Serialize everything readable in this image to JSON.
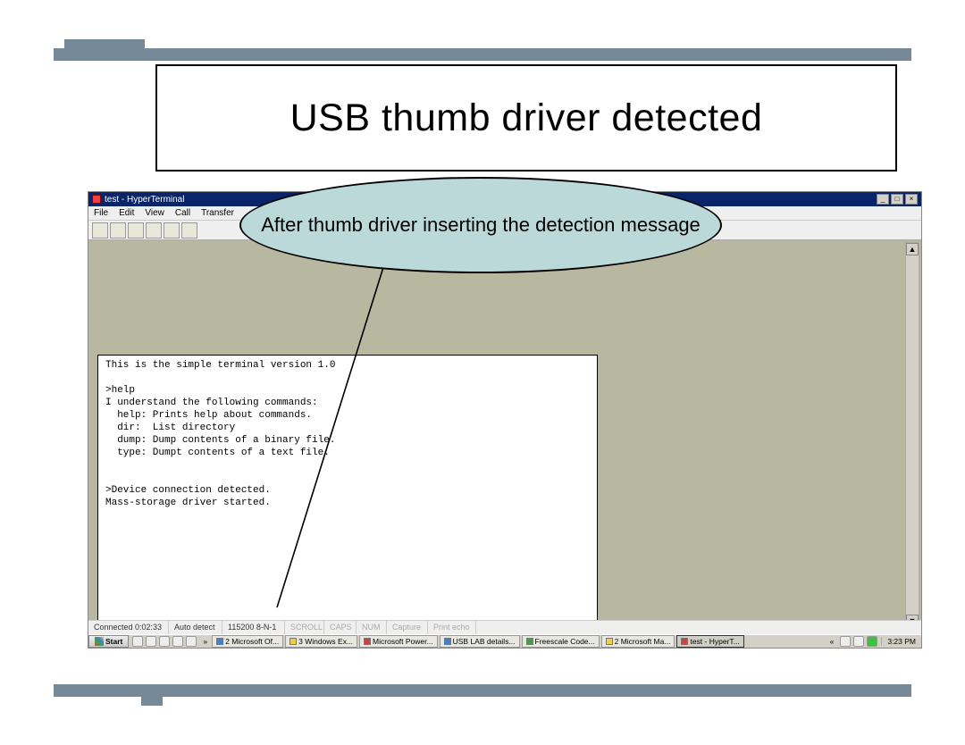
{
  "slide": {
    "title": "USB thumb driver detected",
    "callout": "After thumb driver inserting the detection message"
  },
  "window": {
    "title": "test - HyperTerminal",
    "menu": [
      "File",
      "Edit",
      "View",
      "Call",
      "Transfer"
    ],
    "buttons": {
      "min": "_",
      "max": "□",
      "close": "×"
    }
  },
  "terminal": {
    "lines": [
      "This is the simple terminal version 1.0",
      "",
      ">help",
      "I understand the following commands:",
      "  help: Prints help about commands.",
      "  dir:  List directory",
      "  dump: Dump contents of a binary file.",
      "  type: Dumpt contents of a text file.",
      "",
      "",
      ">Device connection detected.",
      "Mass-storage driver started."
    ]
  },
  "status": {
    "connected": "Connected 0:02:33",
    "detect": "Auto detect",
    "baud": "115200 8-N-1",
    "scroll": "SCROLL",
    "caps": "CAPS",
    "num": "NUM",
    "capture": "Capture",
    "echo": "Print echo"
  },
  "taskbar": {
    "start": "Start",
    "items": [
      {
        "label": "2 Microsoft Of...",
        "cls": "b"
      },
      {
        "label": "3 Windows Ex...",
        "cls": "y"
      },
      {
        "label": "Microsoft Power...",
        "cls": "r"
      },
      {
        "label": "USB LAB details...",
        "cls": "b"
      },
      {
        "label": "Freescale Code...",
        "cls": "g"
      },
      {
        "label": "2 Microsoft Ma...",
        "cls": "y"
      },
      {
        "label": "test - HyperT...",
        "cls": "r",
        "active": true
      }
    ],
    "clock": "3:23 PM"
  }
}
